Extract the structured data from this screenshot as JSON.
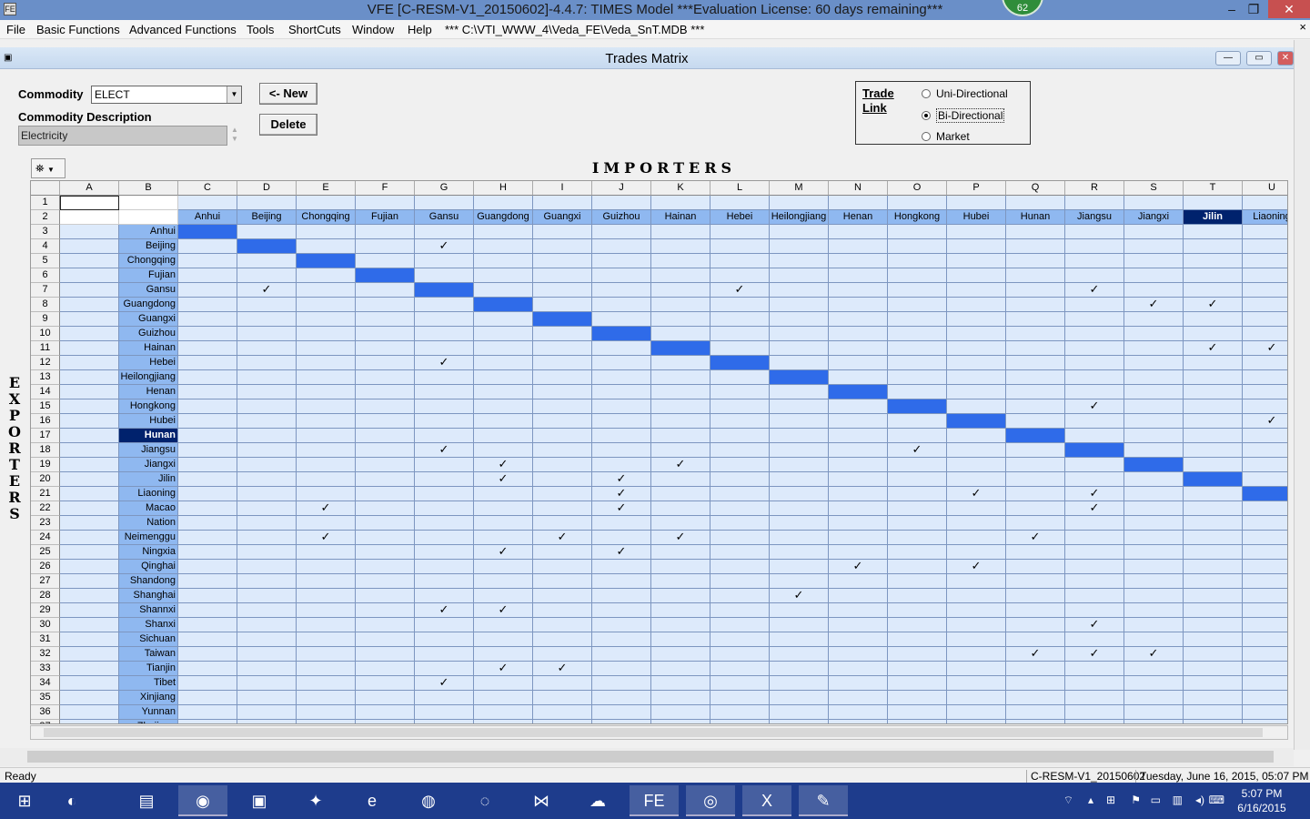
{
  "window": {
    "title": "VFE [C-RESM-V1_20150602]-4.4.7: TIMES Model ***Evaluation License: 60 days remaining***",
    "badge": "62"
  },
  "menu": {
    "items": [
      "File",
      "Basic Functions",
      "Advanced Functions",
      "Tools",
      "ShortCuts",
      "Window",
      "Help"
    ],
    "path": "*** C:\\VTI_WWW_4\\Veda_FE\\Veda_SnT.MDB ***",
    "close_glyph": "×"
  },
  "child": {
    "title": "Trades Matrix"
  },
  "form": {
    "commodity_label": "Commodity",
    "commodity_value": "ELECT",
    "description_label": "Commodity Description",
    "description_value": "Electricity",
    "new_button": "<- New",
    "delete_button": "Delete",
    "trade_link_label": "Trade Link",
    "options": [
      "Uni-Directional",
      "Bi-Directional",
      "Market"
    ],
    "selected_option": 1
  },
  "grid": {
    "importers_label": "IMPORTERS",
    "exporters_label": "EXPORTERS",
    "col_letters": [
      "A",
      "B",
      "C",
      "D",
      "E",
      "F",
      "G",
      "H",
      "I",
      "J",
      "K",
      "L",
      "M",
      "N",
      "O",
      "P",
      "Q",
      "R",
      "S",
      "T",
      "U"
    ],
    "importers": [
      "Anhui",
      "Beijing",
      "Chongqing",
      "Fujian",
      "Gansu",
      "Guangdong",
      "Guangxi",
      "Guizhou",
      "Hainan",
      "Hebei",
      "Heilongjiang",
      "Henan",
      "Hongkong",
      "Hubei",
      "Hunan",
      "Jiangsu",
      "Jiangxi",
      "Jilin",
      "Liaoning"
    ],
    "selected_importer": 17,
    "exporters": [
      "Anhui",
      "Beijing",
      "Chongqing",
      "Fujian",
      "Gansu",
      "Guangdong",
      "Guangxi",
      "Guizhou",
      "Hainan",
      "Hebei",
      "Heilongjiang",
      "Henan",
      "Hongkong",
      "Hubei",
      "Hunan",
      "Jiangsu",
      "Jiangxi",
      "Jilin",
      "Liaoning",
      "Macao",
      "Nation",
      "Neimenggu",
      "Ningxia",
      "Qinghai",
      "Shandong",
      "Shanghai",
      "Shannxi",
      "Shanxi",
      "Sichuan",
      "Taiwan",
      "Tianjin",
      "Tibet",
      "Xinjiang",
      "Yunnan",
      "Zhejiang"
    ],
    "selected_exporter": 14,
    "check_glyph": "✓",
    "checks": [
      [
        1,
        4
      ],
      [
        4,
        1
      ],
      [
        4,
        9
      ],
      [
        4,
        15
      ],
      [
        5,
        16
      ],
      [
        5,
        17
      ],
      [
        8,
        17
      ],
      [
        8,
        18
      ],
      [
        9,
        4
      ],
      [
        12,
        15
      ],
      [
        13,
        18
      ],
      [
        15,
        4
      ],
      [
        15,
        12
      ],
      [
        16,
        5
      ],
      [
        16,
        8
      ],
      [
        17,
        5
      ],
      [
        17,
        7
      ],
      [
        18,
        7
      ],
      [
        18,
        13
      ],
      [
        18,
        15
      ],
      [
        19,
        7
      ],
      [
        19,
        15
      ],
      [
        19,
        2
      ],
      [
        21,
        2
      ],
      [
        21,
        6
      ],
      [
        21,
        8
      ],
      [
        21,
        14
      ],
      [
        22,
        5
      ],
      [
        22,
        7
      ],
      [
        23,
        11
      ],
      [
        23,
        13
      ],
      [
        25,
        10
      ],
      [
        26,
        4
      ],
      [
        26,
        5
      ],
      [
        27,
        15
      ],
      [
        29,
        14
      ],
      [
        29,
        15
      ],
      [
        29,
        16
      ],
      [
        30,
        5
      ],
      [
        30,
        6
      ],
      [
        31,
        4
      ]
    ]
  },
  "status": {
    "left": "Ready",
    "model": "C-RESM-V1_20150602",
    "datetime": "Tuesday, June 16, 2015, 05:07 PM"
  },
  "taskbar": {
    "time": "5:07 PM",
    "date": "6/16/2015"
  }
}
